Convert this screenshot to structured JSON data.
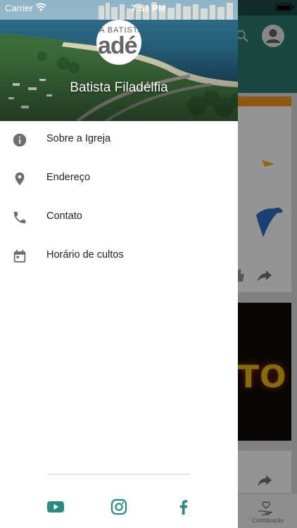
{
  "status_bar": {
    "carrier": "Carrier",
    "time": "7:51 PM",
    "battery_level": 1.0
  },
  "drawer": {
    "header": {
      "logo_small_text": "A BATISTA",
      "logo_big_text": "adé",
      "church_name": "Batista Filadélfia"
    },
    "menu": [
      {
        "label": "Sobre a Igreja",
        "icon": "info-icon"
      },
      {
        "label": "Endereço",
        "icon": "location-pin-icon"
      },
      {
        "label": "Contato",
        "icon": "phone-icon"
      },
      {
        "label": "Horário de cultos",
        "icon": "calendar-icon"
      }
    ],
    "social": [
      {
        "icon": "youtube-icon"
      },
      {
        "icon": "instagram-icon"
      },
      {
        "icon": "facebook-icon"
      }
    ]
  },
  "background": {
    "card2_text": "TO",
    "bottom_nav_label": "Contribuição"
  },
  "colors": {
    "accent": "#2a8a7f",
    "app_bar": "#2f7a70",
    "menu_icon": "#6e6e6e",
    "menu_text": "#1f1f1f"
  }
}
